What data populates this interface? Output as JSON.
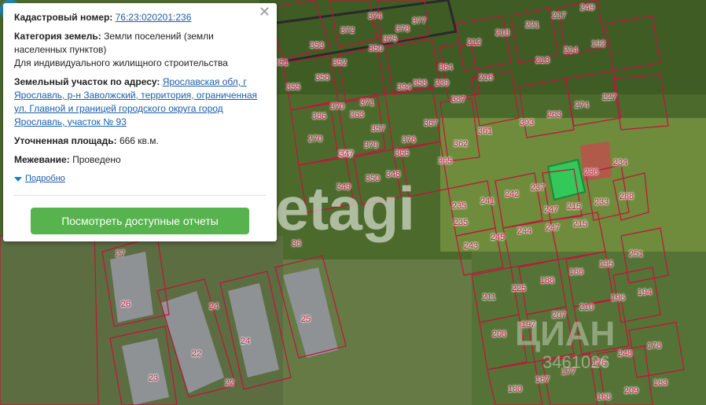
{
  "card": {
    "cadastral_label": "Кадастровый номер:",
    "cadastral_value": "76:23:020201:236",
    "category_label": "Категория земель:",
    "category_value": "Земли поселений (земли населенных пунктов)",
    "category_use": "Для индивидуального жилищного строительства",
    "address_label": "Земельный участок по адресу:",
    "address_value": "Ярославская обл, г Ярославль, р-н Заволжский, территория, ограниченная ул. Главной и границей городского округа город Ярославль, участок № 93",
    "area_label": "Уточненная площадь:",
    "area_value": "666 кв.м.",
    "survey_label": "Межевание:",
    "survey_value": "Проведено",
    "more_label": "Подробно",
    "reports_button": "Посмотреть доступные отчеты",
    "close_icon": "close-icon"
  },
  "map": {
    "watermark": "etagi",
    "watermark2": "ЦИАН",
    "watermark3": "3461026",
    "highlight_color": "#34c759",
    "boundary_color": "#c0143c",
    "pin_color": "#1f84c6",
    "pin_icon": "map-pin-icon",
    "plot_labels": [
      "374",
      "372",
      "378",
      "377",
      "217",
      "249",
      "353",
      "375",
      "212",
      "218",
      "221",
      "214",
      "192",
      "351",
      "352",
      "350",
      "213",
      "355",
      "356",
      "364",
      "216",
      "239",
      "358",
      "360",
      "394",
      "274",
      "227",
      "370",
      "371",
      "386",
      "387",
      "363",
      "367",
      "361",
      "393",
      "263",
      "270",
      "357",
      "376",
      "379",
      "366",
      "362",
      "373",
      "365",
      "347",
      "348",
      "236",
      "234",
      "349",
      "350",
      "242",
      "237",
      "235",
      "241",
      "233",
      "247",
      "288",
      "215",
      "235",
      "244",
      "247",
      "215",
      "245",
      "243",
      "251",
      "27",
      "195",
      "188",
      "186",
      "36",
      "225",
      "26",
      "211",
      "210",
      "196",
      "194",
      "24",
      "207",
      "208",
      "197",
      "25",
      "22",
      "24",
      "248",
      "178",
      "23",
      "176",
      "22",
      "167",
      "180",
      "183",
      "177",
      "209",
      "168"
    ]
  }
}
